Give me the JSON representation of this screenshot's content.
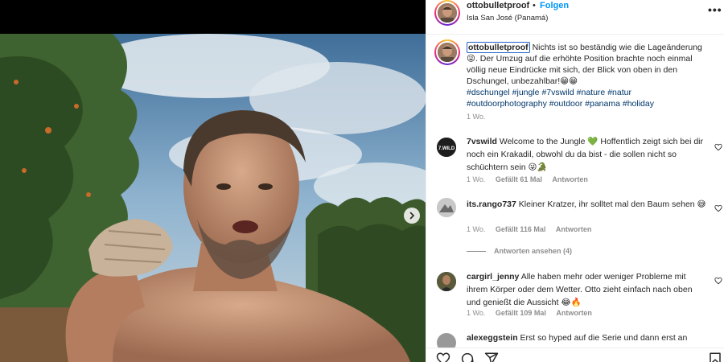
{
  "post": {
    "username": "ottobulletproof",
    "separator": "•",
    "follow_label": "Folgen",
    "location": "Isla San José (Panamá)",
    "more_label": "•••"
  },
  "caption": {
    "username": "ottobulletproof",
    "text": "Nichts ist so beständig wie die Lageänderung 😜. Der Umzug auf die erhöhte Position brachte noch einmal völlig neue Eindrücke mit sich, der Blick von oben in den Dschungel, unbezahlbar!😁😁",
    "hashtags": [
      "#dschungel",
      "#jungle",
      "#7vswild",
      "#nature",
      "#natur",
      "#outdoorphotography",
      "#outdoor",
      "#panama",
      "#holiday"
    ],
    "time": "1 Wo."
  },
  "comments": [
    {
      "username": "7vswild",
      "avatar_text": "7.WILD",
      "text": "Welcome to the Jungle 💚 Hoffentlich zeigt sich bei dir noch ein Krakadil, obwohl du da bist - die sollen nicht so schüchtern sein 😜🐊",
      "time": "1 Wo.",
      "likes": "Gefällt 61 Mal",
      "reply": "Antworten"
    },
    {
      "username": "its.rango737",
      "text": "Kleiner Kratzer, ihr solltet mal den Baum sehen 😅",
      "time": "1 Wo.",
      "likes": "Gefällt 116 Mal",
      "reply": "Antworten",
      "view_replies": "Antworten ansehen (4)"
    },
    {
      "username": "cargirl_jenny",
      "text": "Alle haben mehr oder weniger Probleme mit ihrem Körper oder dem Wetter. Otto zieht einfach nach oben und genießt die Aussicht 😂🔥",
      "time": "1 Wo.",
      "likes": "Gefällt 109 Mal",
      "reply": "Antworten"
    },
    {
      "username": "alexeggstein",
      "text": "Erst so hyped auf die Serie und dann erst an"
    }
  ],
  "icons": {
    "heart": "heart-icon",
    "comment": "comment-icon",
    "share": "share-icon",
    "save": "bookmark-icon",
    "next": "chevron-right-icon",
    "more": "more-horizontal-icon"
  },
  "colors": {
    "link": "#0095f6",
    "hashtag": "#00376b",
    "meta": "#8e8e8e",
    "text": "#262626"
  }
}
